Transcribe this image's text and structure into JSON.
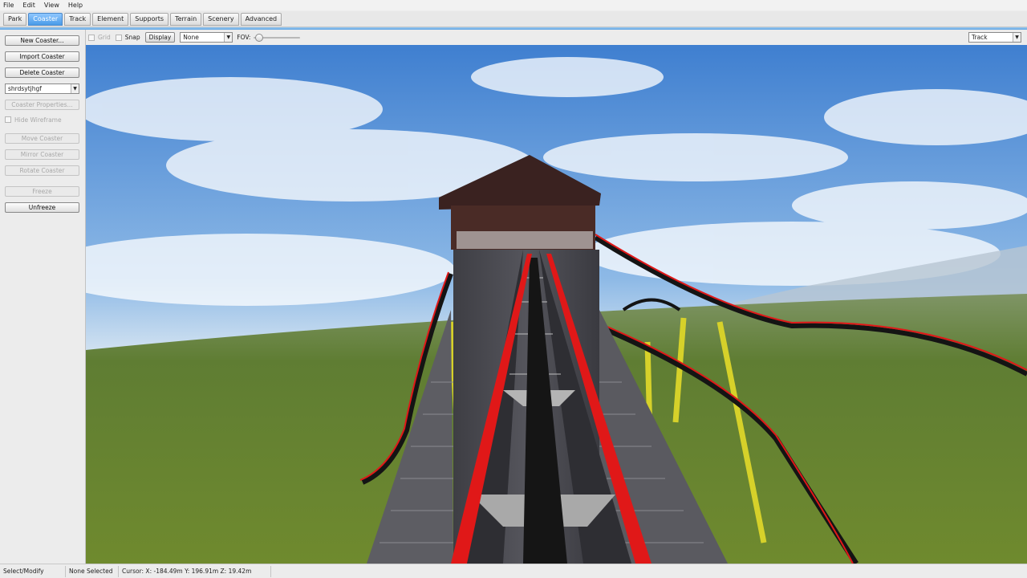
{
  "menubar": {
    "items": [
      "File",
      "Edit",
      "View",
      "Help"
    ]
  },
  "tabs": [
    {
      "label": "Park",
      "active": false
    },
    {
      "label": "Coaster",
      "active": true
    },
    {
      "label": "Track",
      "active": false
    },
    {
      "label": "Element",
      "active": false
    },
    {
      "label": "Supports",
      "active": false
    },
    {
      "label": "Terrain",
      "active": false
    },
    {
      "label": "Scenery",
      "active": false
    },
    {
      "label": "Advanced",
      "active": false
    }
  ],
  "leftpanel": {
    "new_coaster": "New Coaster...",
    "import_coaster": "Import Coaster",
    "delete_coaster": "Delete Coaster",
    "coaster_select": "shrdsytjhgf",
    "coaster_properties": "Coaster Properties...",
    "hide_wireframe": "Hide Wireframe",
    "move_coaster": "Move Coaster",
    "mirror_coaster": "Mirror Coaster",
    "rotate_coaster": "Rotate Coaster",
    "freeze": "Freeze",
    "unfreeze": "Unfreeze"
  },
  "toolbar": {
    "grid_label": "Grid",
    "snap_label": "Snap",
    "display_button": "Display",
    "display_select": "None",
    "fov_label": "FOV:",
    "fov_fraction": 0.05,
    "view_select": "Track"
  },
  "statusbar": {
    "mode": "Select/Modify",
    "selection": "None Selected",
    "cursor": "Cursor: X: -184.49m Y: 196.91m Z: 19.42m"
  },
  "colors": {
    "accent_tab": "#4a9be8",
    "track_rail": "#e01818",
    "supports": "#d6d12a",
    "sky_top": "#4a88d6",
    "grass": "#6b8a34"
  },
  "icons": {
    "dropdown": "chevron-down-icon"
  }
}
